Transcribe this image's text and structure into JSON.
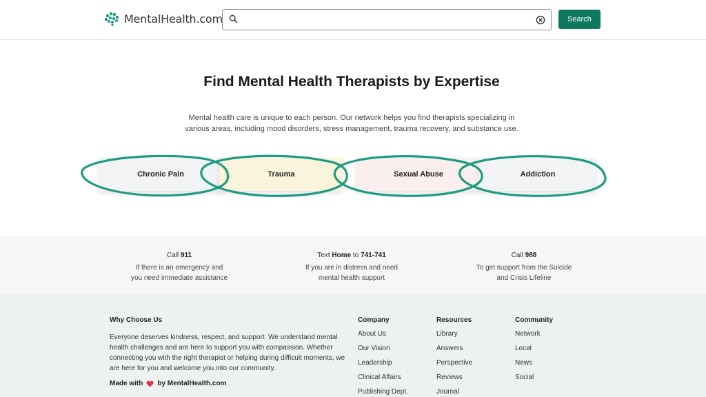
{
  "header": {
    "logo_text": "MentalHealth.com",
    "search_placeholder": "",
    "search_value": "",
    "search_button": "Search"
  },
  "main": {
    "title": "Find Mental Health Therapists by Expertise",
    "intro": "Mental health care is unique to each person. Our network helps you find therapists specializing in various areas, including mood disorders, stress management, trauma recovery, and substance use.",
    "categories": [
      {
        "label": "Chronic Pain"
      },
      {
        "label": "Trauma"
      },
      {
        "label": "Sexual Abuse"
      },
      {
        "label": "Addiction"
      }
    ]
  },
  "help": [
    {
      "prefix": "Call ",
      "bold": "911",
      "suffix": "",
      "line1": "If there is an emergency and",
      "line2": "you need immediate assistance"
    },
    {
      "prefix": "Text ",
      "bold": "Home",
      "suffix": " to ",
      "bold2": "741-741",
      "line1": "If you are in distress and need",
      "line2": "mental health support"
    },
    {
      "prefix": "Call ",
      "bold": "988",
      "suffix": "",
      "line1": "To get support from the Suicide",
      "line2": "and Crisis Lifeline"
    }
  ],
  "footer": {
    "why_title": "Why Choose Us",
    "why_text": "Everyone deserves kindness, respect, and support. We understand mental health challenges and are here to support you with compassion. Whether connecting you with the right therapist or helping during difficult moments, we are here for you and welcome you into our community.",
    "made_with_prefix": "Made with",
    "made_with_suffix": "by MentalHealth.com",
    "columns": [
      {
        "title": "Company",
        "links": [
          "About Us",
          "Our Vision",
          "Leadership",
          "Clinical Affairs",
          "Publishing Dept."
        ]
      },
      {
        "title": "Resources",
        "links": [
          "Library",
          "Answers",
          "Perspective",
          "Reviews",
          "Journal"
        ]
      },
      {
        "title": "Community",
        "links": [
          "Network",
          "Local",
          "News",
          "Social"
        ]
      }
    ]
  },
  "colors": {
    "brand_green": "#0d7a5f",
    "annotation_teal": "#1e9c80",
    "heart_red": "#e0344a"
  },
  "icons": [
    "brain-logo-icon",
    "search-icon",
    "clear-icon",
    "heart-icon"
  ]
}
